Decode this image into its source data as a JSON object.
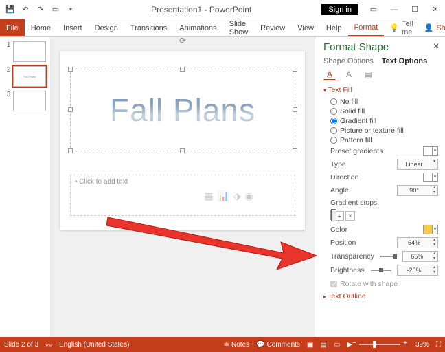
{
  "app": {
    "title": "Presentation1 - PowerPoint"
  },
  "signin": "Sign in",
  "ribbon": {
    "file": "File",
    "tabs": [
      "Home",
      "Insert",
      "Design",
      "Transitions",
      "Animations",
      "Slide Show",
      "Review",
      "View",
      "Help"
    ],
    "context_tab": "Format",
    "tellme": "Tell me",
    "share": "Share"
  },
  "thumbs": [
    {
      "num": "1",
      "label": ""
    },
    {
      "num": "2",
      "label": "Fall Plans"
    },
    {
      "num": "3",
      "label": ""
    }
  ],
  "slide": {
    "title_text": "Fall Plans",
    "content_placeholder": "• Click to add text"
  },
  "format_pane": {
    "title": "Format Shape",
    "tab_shape": "Shape Options",
    "tab_text": "Text Options",
    "section_fill": "Text Fill",
    "opt_nofill": "No fill",
    "opt_solid": "Solid fill",
    "opt_gradient": "Gradient fill",
    "opt_picture": "Picture or texture fill",
    "opt_pattern": "Pattern fill",
    "preset": "Preset gradients",
    "type_lbl": "Type",
    "type_val": "Linear",
    "direction": "Direction",
    "angle_lbl": "Angle",
    "angle_val": "90°",
    "stops_lbl": "Gradient stops",
    "color_lbl": "Color",
    "position_lbl": "Position",
    "position_val": "64%",
    "transp_lbl": "Transparency",
    "transp_val": "65%",
    "bright_lbl": "Brightness",
    "bright_val": "-25%",
    "rotate": "Rotate with shape",
    "section_outline": "Text Outline"
  },
  "status": {
    "slide": "Slide 2 of 3",
    "lang": "English (United States)",
    "notes": "Notes",
    "comments": "Comments",
    "zoom": "39%"
  }
}
